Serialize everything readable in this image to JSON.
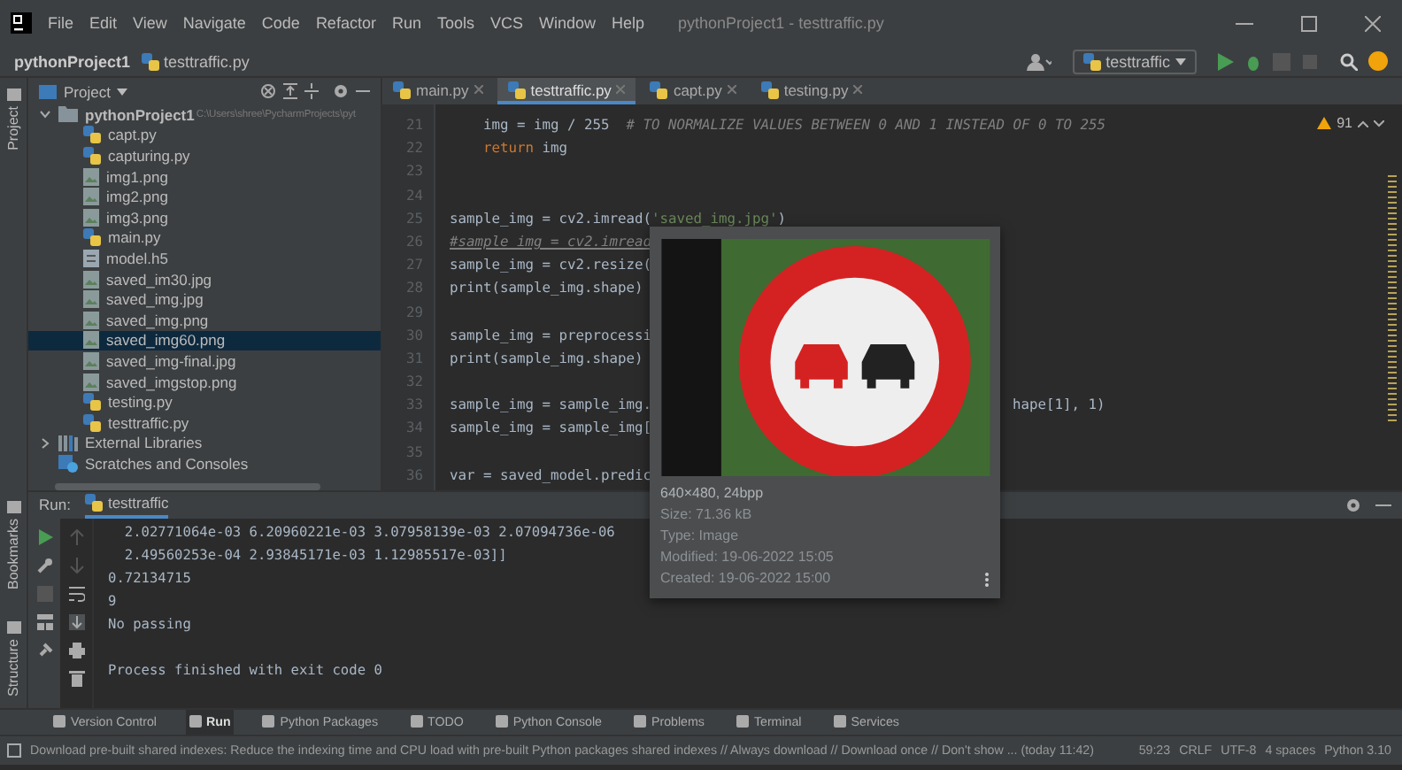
{
  "window": {
    "title": "pythonProject1 - testtraffic.py"
  },
  "menu": [
    "File",
    "Edit",
    "View",
    "Navigate",
    "Code",
    "Refactor",
    "Run",
    "Tools",
    "VCS",
    "Window",
    "Help"
  ],
  "breadcrumb": [
    "pythonProject1",
    "testtraffic.py"
  ],
  "run_config": "testtraffic",
  "left_stripe": [
    "Project",
    "Bookmarks",
    "Structure"
  ],
  "project_panel": {
    "title": "Project",
    "tree": [
      {
        "label": "pythonProject1",
        "path": "C:\\Users\\shree\\PycharmProjects\\pyt",
        "kind": "folder",
        "expanded": true,
        "selected": false,
        "children": [
          {
            "label": "capt.py",
            "kind": "python",
            "selected": false
          },
          {
            "label": "capturing.py",
            "kind": "python",
            "selected": false
          },
          {
            "label": "img1.png",
            "kind": "image",
            "selected": false
          },
          {
            "label": "img2.png",
            "kind": "image",
            "selected": false
          },
          {
            "label": "img3.png",
            "kind": "image",
            "selected": false
          },
          {
            "label": "main.py",
            "kind": "python",
            "selected": false
          },
          {
            "label": "model.h5",
            "kind": "file",
            "selected": false
          },
          {
            "label": "saved_im30.jpg",
            "kind": "image",
            "selected": false
          },
          {
            "label": "saved_img.jpg",
            "kind": "image",
            "selected": false
          },
          {
            "label": "saved_img.png",
            "kind": "image",
            "selected": false
          },
          {
            "label": "saved_img60.png",
            "kind": "image",
            "selected": true
          },
          {
            "label": "saved_img-final.jpg",
            "kind": "image",
            "selected": false
          },
          {
            "label": "saved_imgstop.png",
            "kind": "image",
            "selected": false
          },
          {
            "label": "testing.py",
            "kind": "python",
            "selected": false
          },
          {
            "label": "testtraffic.py",
            "kind": "python",
            "selected": false
          }
        ]
      },
      {
        "label": "External Libraries",
        "kind": "library",
        "expanded": false,
        "selected": false
      },
      {
        "label": "Scratches and Consoles",
        "kind": "scratch",
        "selected": false
      }
    ]
  },
  "editor_tabs": [
    {
      "label": "main.py",
      "selected": false
    },
    {
      "label": "testtraffic.py",
      "selected": true
    },
    {
      "label": "capt.py",
      "selected": false
    },
    {
      "label": "testing.py",
      "selected": false
    }
  ],
  "editor": {
    "warnings": "91",
    "lines": [
      {
        "number": "21",
        "segments": [
          {
            "kind": "code",
            "text": "    img = img / 255  "
          },
          {
            "kind": "comment",
            "text": "# TO NORMALIZE VALUES BETWEEN 0 AND 1 INSTEAD OF 0 TO 255"
          }
        ]
      },
      {
        "number": "22",
        "segments": [
          {
            "kind": "keyword",
            "text": "    return "
          },
          {
            "kind": "code",
            "text": "img"
          }
        ]
      },
      {
        "number": "23"
      },
      {
        "number": "24"
      },
      {
        "number": "25",
        "segments": [
          {
            "kind": "code",
            "text": "sample_img = cv2.imread("
          },
          {
            "kind": "string",
            "text": "'saved_img.jpg'"
          },
          {
            "kind": "code",
            "text": ")"
          }
        ]
      },
      {
        "number": "26",
        "segments": [
          {
            "kind": "comment",
            "text": "#sample_img = cv2.imread"
          }
        ]
      },
      {
        "number": "27",
        "segments": [
          {
            "kind": "code",
            "text": "sample_img = cv2.resize("
          }
        ]
      },
      {
        "number": "28",
        "segments": [
          {
            "kind": "code",
            "text": "print(sample_img.shape)"
          }
        ]
      },
      {
        "number": "29"
      },
      {
        "number": "30",
        "segments": [
          {
            "kind": "code",
            "text": "sample_img = preprocessi"
          }
        ]
      },
      {
        "number": "31",
        "segments": [
          {
            "kind": "code",
            "text": "print(sample_img.shape)"
          }
        ]
      },
      {
        "number": "32"
      },
      {
        "number": "33",
        "segments": [
          {
            "kind": "code",
            "text": "sample_img = sample_img."
          }
        ],
        "tail": "hape[1], 1)"
      },
      {
        "number": "34",
        "segments": [
          {
            "kind": "code",
            "text": "sample_img = sample_img["
          }
        ]
      },
      {
        "number": "35"
      },
      {
        "number": "36",
        "segments": [
          {
            "kind": "code",
            "text": "var = saved_model.predic"
          }
        ]
      }
    ]
  },
  "image_popup": {
    "info": [
      "640×480, 24bpp",
      "Size: 71.36 kB",
      "Type: Image",
      "Modified: 19-06-2022 15:05",
      "Created: 19-06-2022 15:00"
    ]
  },
  "run_panel": {
    "title": "Run:",
    "tab": "testtraffic",
    "output": [
      "  2.02771064e-03 6.20960221e-03 3.07958139e-03 2.07094736e-06",
      "  2.49560253e-04 2.93845171e-03 1.12985517e-03]]",
      "0.72134715",
      "9",
      "No passing"
    ],
    "footer": "Process finished with exit code 0"
  },
  "tool_windows": [
    {
      "label": "Version Control",
      "selected": false
    },
    {
      "label": "Run",
      "selected": true
    },
    {
      "label": "Python Packages",
      "selected": false
    },
    {
      "label": "TODO",
      "selected": false
    },
    {
      "label": "Python Console",
      "selected": false
    },
    {
      "label": "Problems",
      "selected": false
    },
    {
      "label": "Terminal",
      "selected": false
    },
    {
      "label": "Services",
      "selected": false
    }
  ],
  "status_bar": {
    "message": "Download pre-built shared indexes: Reduce the indexing time and CPU load with pre-built Python packages shared indexes // Always download // Download once // Don't show ... (today 11:42)",
    "items": [
      "59:23",
      "CRLF",
      "UTF-8",
      "4 spaces",
      "Python 3.10"
    ]
  }
}
